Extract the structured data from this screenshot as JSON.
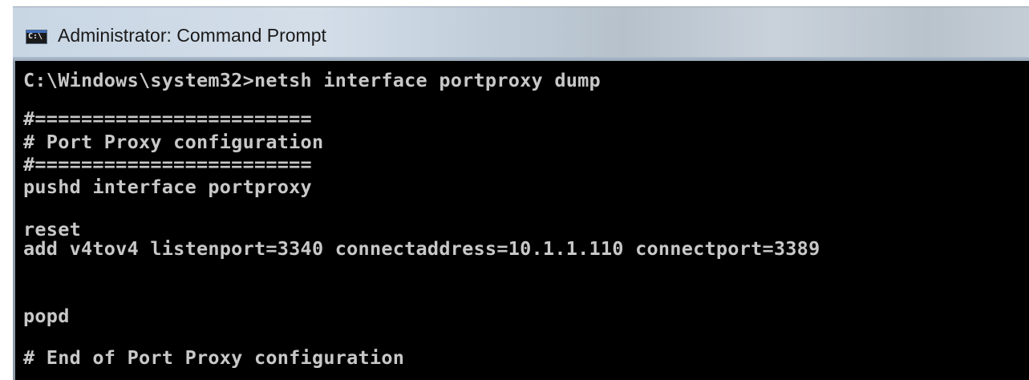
{
  "window": {
    "title": "Administrator: Command Prompt",
    "icon": "cmd-icon",
    "icon_glyph": "C:\\"
  },
  "console": {
    "lines": [
      "C:\\Windows\\system32>netsh interface portproxy dump",
      "#========================",
      "# Port Proxy configuration",
      "#========================",
      "pushd interface portproxy",
      "reset",
      "add v4tov4 listenport=3340 connectaddress=10.1.1.110 connectport=3389",
      "popd",
      "# End of Port Proxy configuration"
    ]
  },
  "colors": {
    "console_background": "#000000",
    "console_text": "#c8c8c8"
  }
}
